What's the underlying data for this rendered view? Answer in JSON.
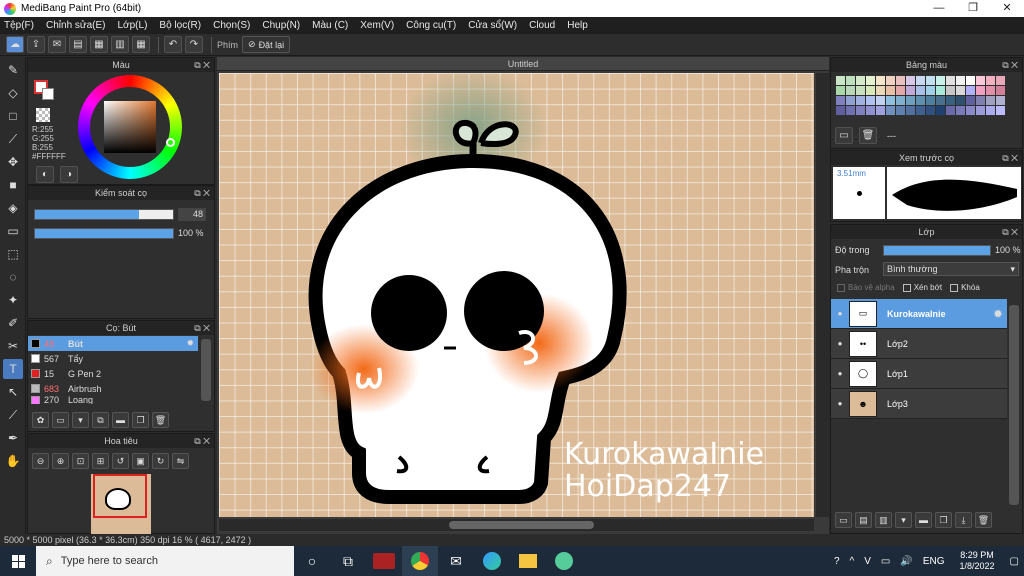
{
  "window": {
    "title": "MediBang Paint Pro (64bit)",
    "minimize": "—",
    "maximize": "❐",
    "close": "✕"
  },
  "menu": [
    "Tệp(F)",
    "Chỉnh sửa(E)",
    "Lớp(L)",
    "Bộ lọc(R)",
    "Chọn(S)",
    "Chụp(N)",
    "Màu (C)",
    "Xem(V)",
    "Công cụ(T)",
    "Cửa sổ(W)",
    "Cloud",
    "Help"
  ],
  "toolbar": {
    "key_label": "Phím",
    "reset_label": "Đặt lại"
  },
  "color_panel": {
    "title": "Màu",
    "r": "R:255",
    "g": "G:255",
    "b": "B:255",
    "hex": "#FFFFFF"
  },
  "brush_control": {
    "title": "Kiểm soát cọ",
    "size": "48",
    "opacity": "100 %",
    "size_fraction": 0.75,
    "opacity_fraction": 1.0
  },
  "brush_list": {
    "title": "Cọ: Bút",
    "items": [
      {
        "num": "48",
        "name": "Bút",
        "color": "#000000",
        "active": true
      },
      {
        "num": "567",
        "name": "Tẩy",
        "color": "#ffffff"
      },
      {
        "num": "15",
        "name": "G Pen 2",
        "color": "#e02020"
      },
      {
        "num": "683",
        "name": "Airbrush",
        "color": "#bbbbbb"
      },
      {
        "num": "270",
        "name": "Loang",
        "color": "#ff77ff"
      }
    ]
  },
  "navigator": {
    "title": "Hoa tiêu"
  },
  "canvas": {
    "tab_title": "Untitled",
    "watermark_line1": "KurokawaInie",
    "watermark_line2": "HoiDap247"
  },
  "status": {
    "text": "5000 * 5000 pixel   (36.3 * 36.3cm)   350 dpi   16 %   ( 4617, 2472 )"
  },
  "palette": {
    "title": "Bảng màu",
    "entry": "---"
  },
  "brush_preview": {
    "title": "Xem trước cọ",
    "size": "3.51mm"
  },
  "layers": {
    "title": "Lớp",
    "opacity_label": "Độ trong",
    "opacity_value": "100 %",
    "opacity_fraction": 1.0,
    "blend_label": "Pha trộn",
    "blend_value": "Bình thường",
    "protect_alpha": "Bảo vệ alpha",
    "clipping": "Xén bớt",
    "lock": "Khóa",
    "items": [
      {
        "name": "KurokawaInie",
        "active": true
      },
      {
        "name": "Lớp2"
      },
      {
        "name": "Lớp1"
      },
      {
        "name": "Lớp3"
      }
    ]
  },
  "taskbar": {
    "search_placeholder": "Type here to search",
    "lang": "ENG",
    "time": "8:29 PM",
    "date": "1/8/2022"
  }
}
